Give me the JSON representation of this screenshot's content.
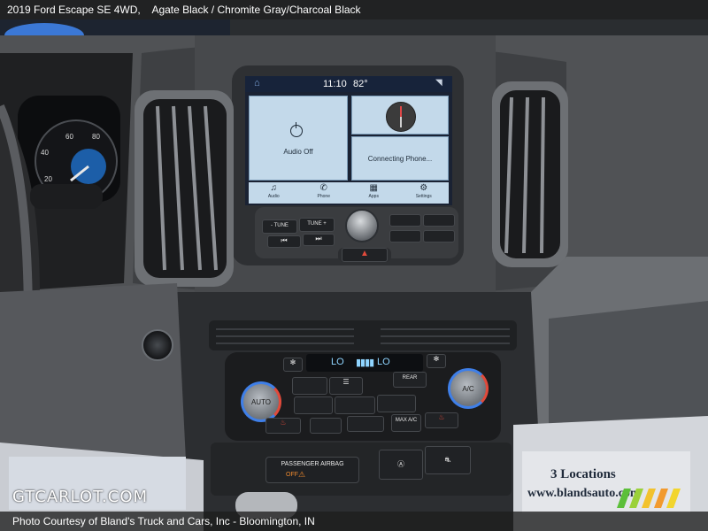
{
  "caption": {
    "vehicle": "2019 Ford Escape SE 4WD,",
    "colors": "Agate Black / Chromite Gray/Charcoal Black"
  },
  "footer": {
    "credit": "Photo Courtesy of Bland's Truck and Cars, Inc - Bloomington, IN"
  },
  "watermark": {
    "text": "GTCARLOT.COM"
  },
  "background_sign": {
    "line1": "3 Locations",
    "line2": "www.blandsauto.com"
  },
  "infotainment": {
    "time": "11:10",
    "temperature": "82°",
    "audio_tile_label": "Audio Off",
    "phone_tile_label": "Connecting Phone...",
    "nav": [
      {
        "icon": "music-note-icon",
        "glyph": "♫",
        "label": "Audio"
      },
      {
        "icon": "phone-icon",
        "glyph": "✆",
        "label": "Phone"
      },
      {
        "icon": "apps-grid-icon",
        "glyph": "▦",
        "label": "Apps"
      },
      {
        "icon": "gear-icon",
        "glyph": "⚙",
        "label": "Settings"
      }
    ]
  },
  "radio_controls": {
    "tune_left": "- TUNE",
    "tune_right": "TUNE +"
  },
  "climate": {
    "left_temp": "LO",
    "right_temp": "LO",
    "fan_readout": "▮▮▮▮",
    "left_knob": "AUTO",
    "right_knob": "A/C",
    "rear_defrost": "REAR",
    "max_ac": "MAX A/C",
    "airbag_label": "PASSENGER AIRBAG",
    "airbag_status": "OFF"
  },
  "gauge": {
    "ticks": [
      "20",
      "40",
      "60",
      "80"
    ]
  },
  "colors": {
    "screen_tile": "#c3d9ea",
    "hot": "#e14a3b",
    "cold": "#3f7fe8",
    "display_text": "#8fd4ff"
  }
}
